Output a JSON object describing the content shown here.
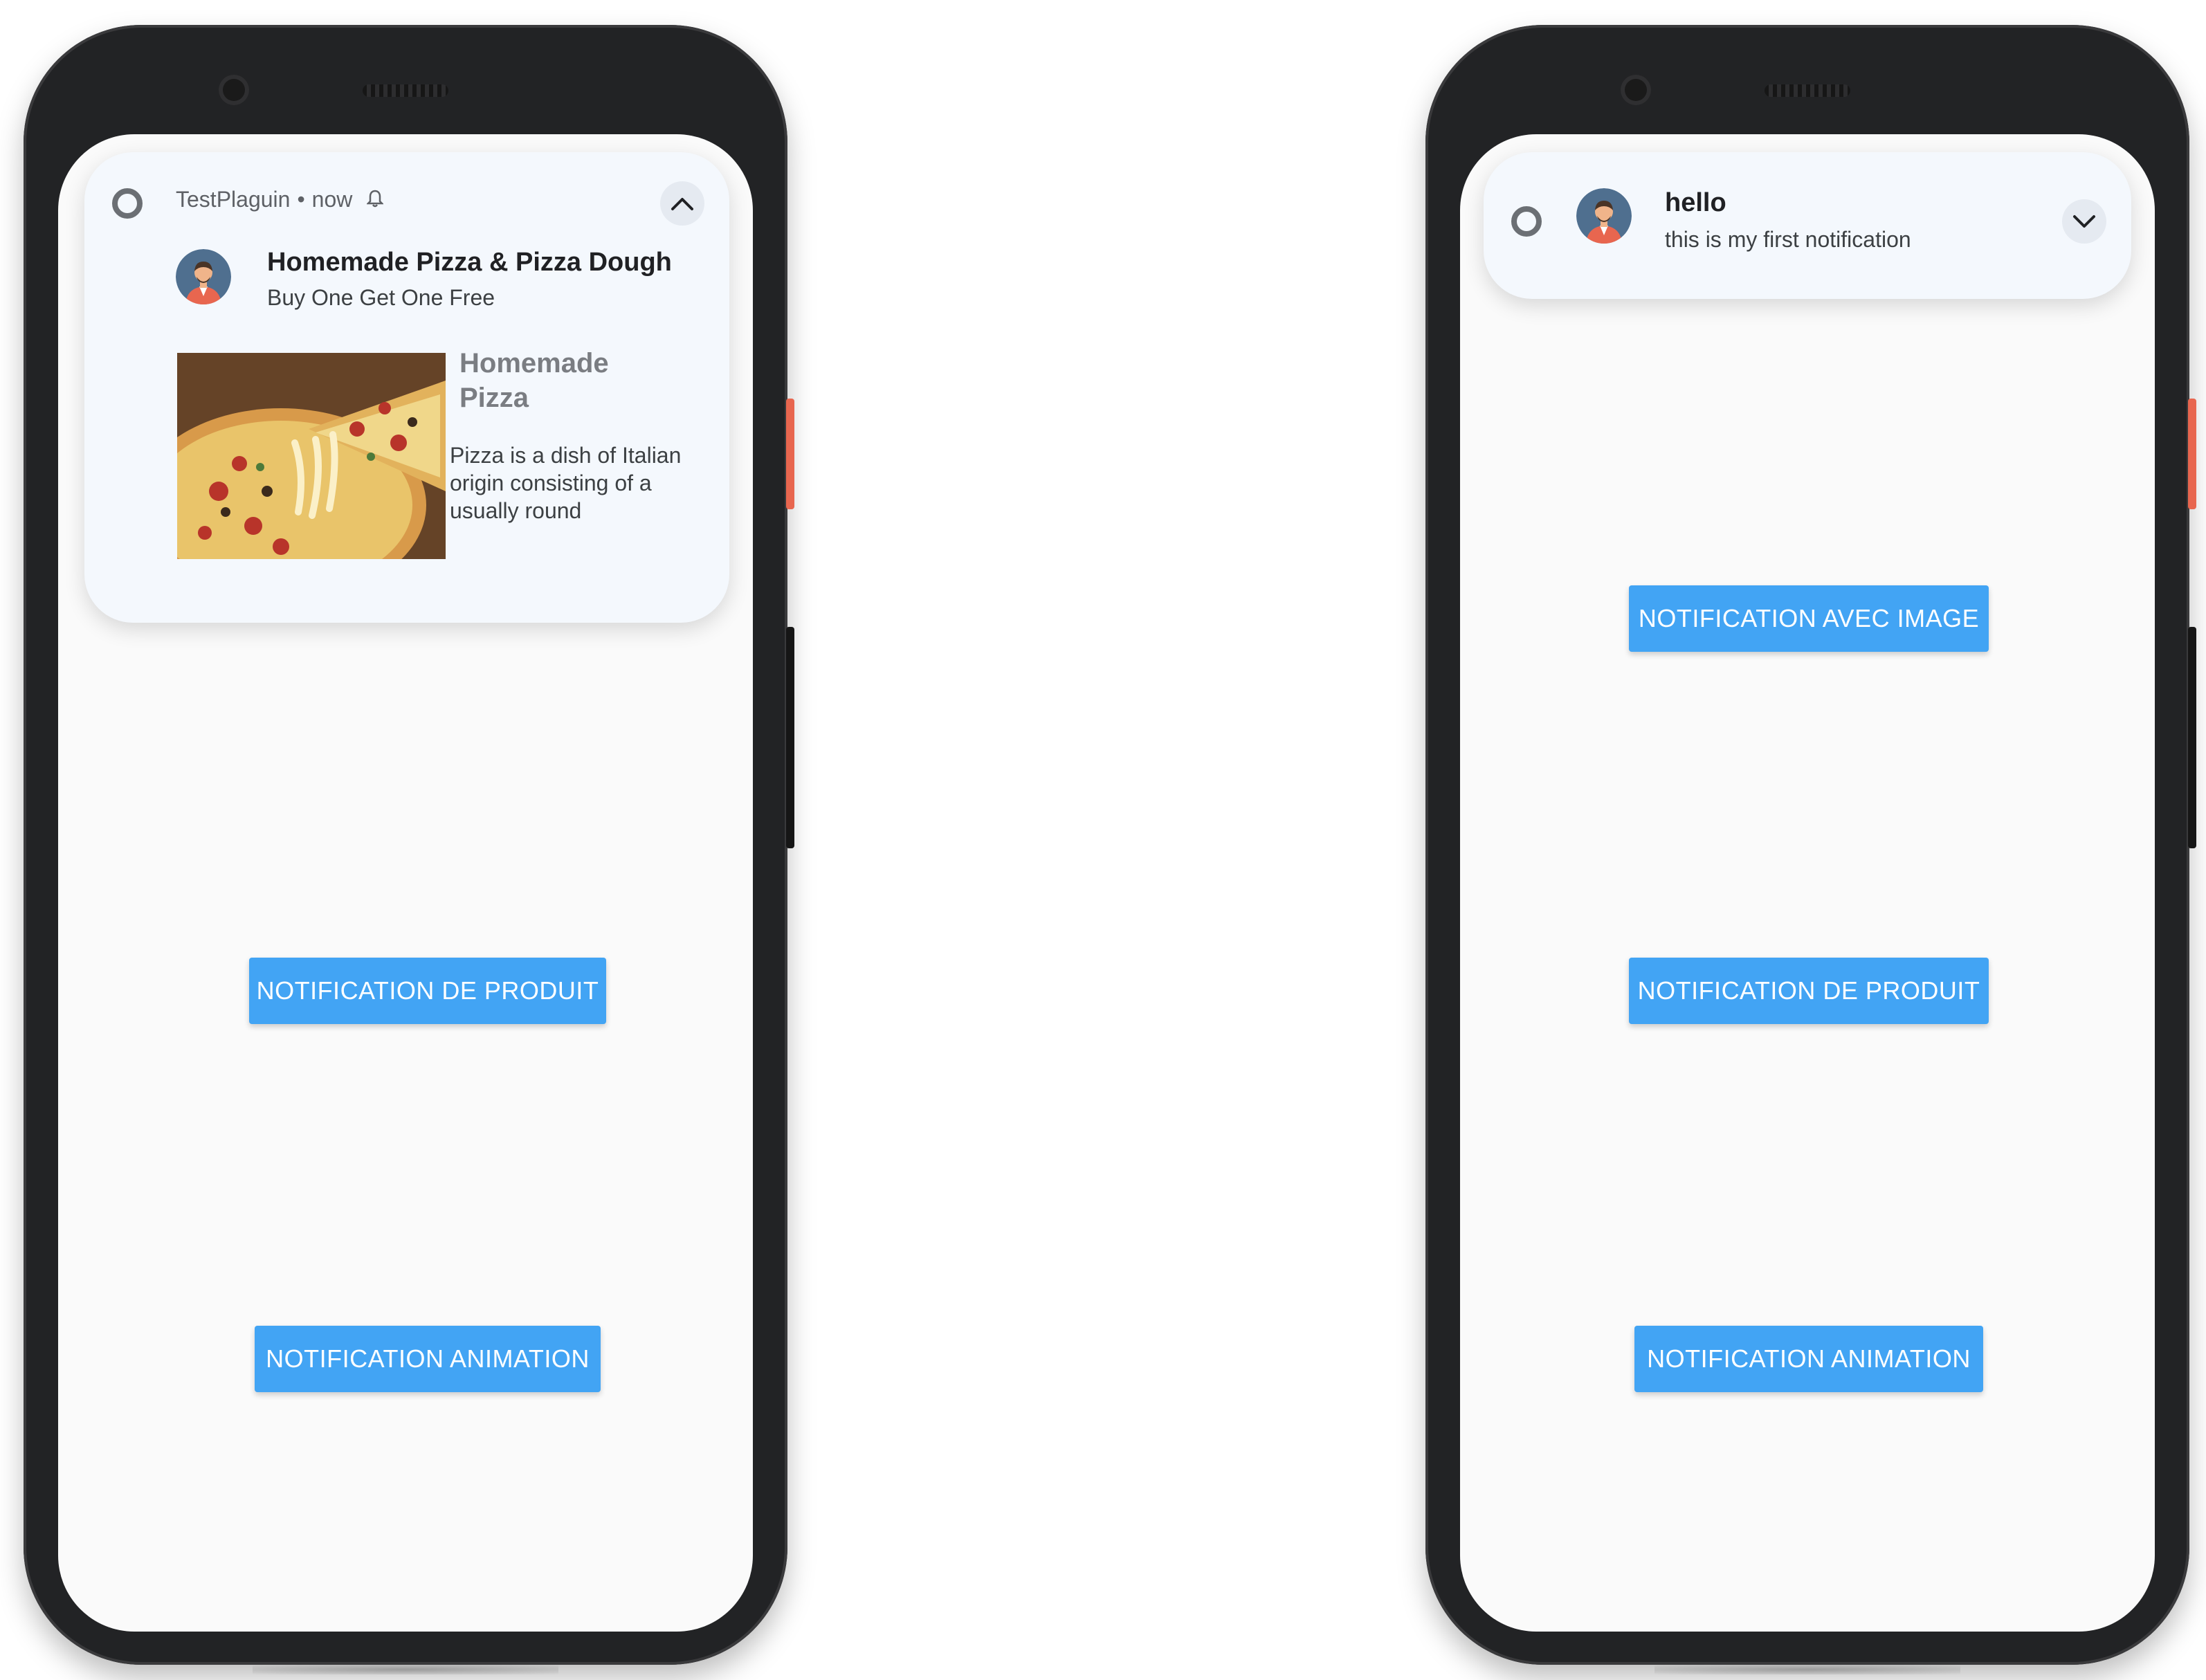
{
  "left_phone": {
    "notification": {
      "app_name": "TestPlaguin",
      "separator": "•",
      "time": "now",
      "title": "Homemade Pizza & Pizza Dough",
      "subtitle": "Buy One Get One Free",
      "big_title": "Homemade Pizza",
      "big_text": "Pizza is a dish of Italian origin consisting of a usually round",
      "icons": [
        "status-ring-icon",
        "bell-icon",
        "chevron-up-icon",
        "avatar",
        "pizza-image"
      ]
    },
    "buttons": {
      "product": "NOTIFICATION DE PRODUIT",
      "animation": "NOTIFICATION ANIMATION"
    }
  },
  "right_phone": {
    "notification": {
      "title": "hello",
      "subtitle": "this is my first notification",
      "icons": [
        "status-ring-icon",
        "avatar",
        "chevron-down-icon"
      ]
    },
    "buttons": {
      "image": "NOTIFICATION AVEC IMAGE",
      "product": "NOTIFICATION DE PRODUIT",
      "animation": "NOTIFICATION ANIMATION"
    }
  },
  "colors": {
    "button": "#42a4f4",
    "phone_frame": "#222325",
    "side_button": "#e8664f",
    "notification_bg": "#f4f8fd"
  }
}
